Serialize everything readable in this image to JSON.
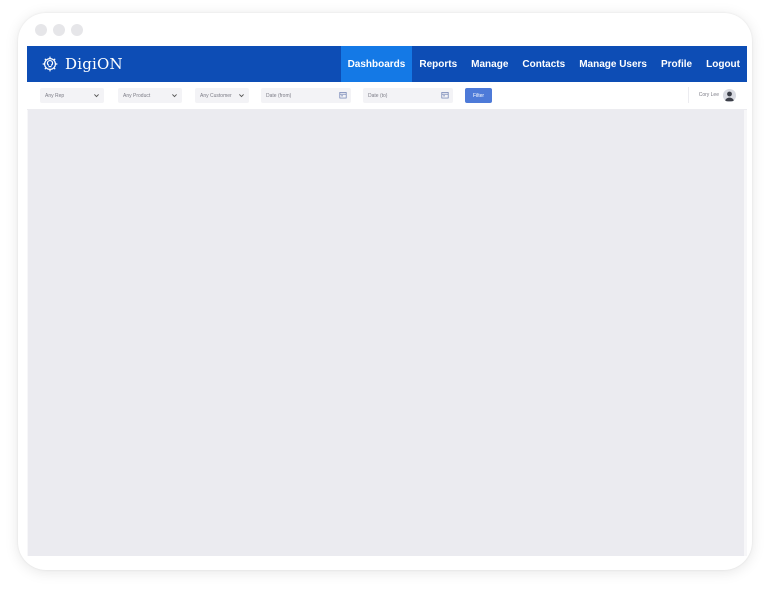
{
  "brand": {
    "name": "DigiON",
    "logo_icon": "gear-bulb-icon"
  },
  "nav": {
    "items": [
      {
        "label": "Dashboards",
        "active": true
      },
      {
        "label": "Reports",
        "active": false
      },
      {
        "label": "Manage",
        "active": false
      },
      {
        "label": "Contacts",
        "active": false
      },
      {
        "label": "Manage Users",
        "active": false
      },
      {
        "label": "Profile",
        "active": false
      },
      {
        "label": "Logout",
        "active": false
      }
    ]
  },
  "filters": {
    "rep": {
      "value": "Any Rep",
      "icon": "chevron-down-icon"
    },
    "product": {
      "value": "Any Product",
      "icon": "chevron-down-icon"
    },
    "customer": {
      "value": "Any Customer",
      "icon": "chevron-down-icon"
    },
    "date_from": {
      "placeholder": "Date (from)",
      "icon": "calendar-icon"
    },
    "date_to": {
      "placeholder": "Date (to)",
      "icon": "calendar-icon"
    },
    "filter_button": "Filter"
  },
  "user": {
    "name": "Cory Lee",
    "avatar_icon": "avatar-icon"
  },
  "colors": {
    "navbar": "#0d4db5",
    "nav_active": "#1479e6",
    "filter_button": "#4d7ad8",
    "content_bg": "#ebebf0"
  }
}
